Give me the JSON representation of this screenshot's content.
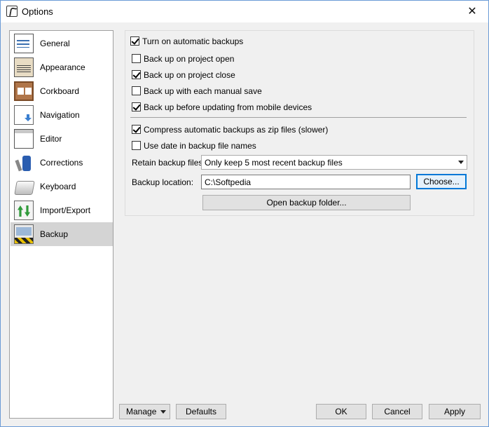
{
  "window": {
    "title": "Options",
    "close_glyph": "✕"
  },
  "sidebar": {
    "items": [
      {
        "label": "General",
        "icon": "checklist-icon"
      },
      {
        "label": "Appearance",
        "icon": "appearance-icon"
      },
      {
        "label": "Corkboard",
        "icon": "corkboard-icon"
      },
      {
        "label": "Navigation",
        "icon": "navigation-icon"
      },
      {
        "label": "Editor",
        "icon": "editor-icon"
      },
      {
        "label": "Corrections",
        "icon": "corrections-icon"
      },
      {
        "label": "Keyboard",
        "icon": "keyboard-icon"
      },
      {
        "label": "Import/Export",
        "icon": "import-export-icon"
      },
      {
        "label": "Backup",
        "icon": "backup-icon",
        "selected": true
      }
    ]
  },
  "backup": {
    "auto_backups": {
      "label": "Turn on automatic backups",
      "checked": true
    },
    "on_open": {
      "label": "Back up on project open",
      "checked": false
    },
    "on_close": {
      "label": "Back up on project close",
      "checked": true
    },
    "manual_save": {
      "label": "Back up with each manual save",
      "checked": false
    },
    "mobile": {
      "label": "Back up before updating from mobile devices",
      "checked": true
    },
    "compress": {
      "label": "Compress automatic backups as zip files (slower)",
      "checked": true
    },
    "use_date": {
      "label": "Use date in backup file names",
      "checked": false
    },
    "retain": {
      "label": "Retain backup files:",
      "value": "Only keep 5 most recent backup files"
    },
    "location": {
      "label": "Backup location:",
      "value": "C:\\Softpedia"
    },
    "choose_label": "Choose...",
    "open_folder_label": "Open backup folder..."
  },
  "footer": {
    "manage_label": "Manage",
    "defaults_label": "Defaults",
    "ok_label": "OK",
    "cancel_label": "Cancel",
    "apply_label": "Apply"
  }
}
